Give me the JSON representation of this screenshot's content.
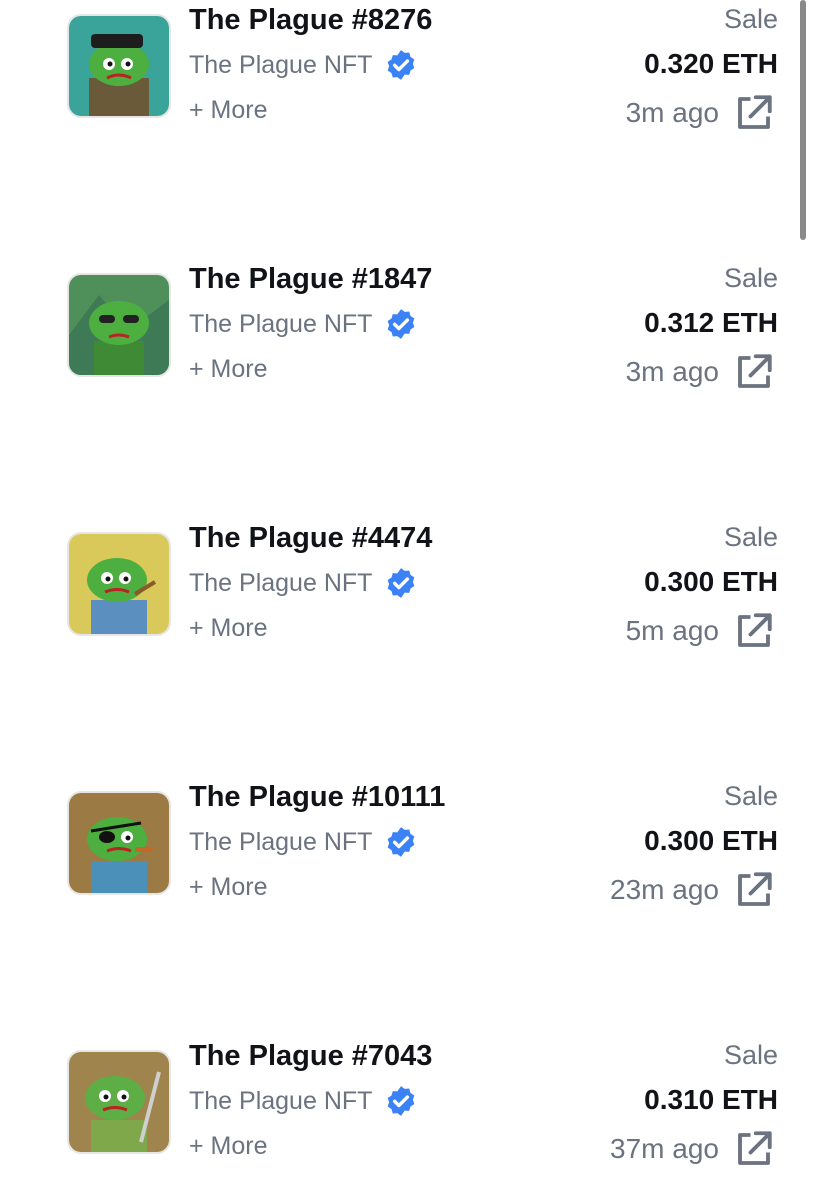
{
  "colors": {
    "title": "#111318",
    "muted": "#6b7280",
    "verified_badge": "#3b82f6"
  },
  "items": [
    {
      "title": "The Plague #8276",
      "collection": "The Plague NFT",
      "more": "+ More",
      "event": "Sale",
      "price": "0.320 ETH",
      "time": "3m ago",
      "thumb_bg": "#3aa39a"
    },
    {
      "title": "The Plague #1847",
      "collection": "The Plague NFT",
      "more": "+ More",
      "event": "Sale",
      "price": "0.312 ETH",
      "time": "3m ago",
      "thumb_bg": "#4f8f5a"
    },
    {
      "title": "The Plague #4474",
      "collection": "The Plague NFT",
      "more": "+ More",
      "event": "Sale",
      "price": "0.300 ETH",
      "time": "5m ago",
      "thumb_bg": "#d9c95a"
    },
    {
      "title": "The Plague #10111",
      "collection": "The Plague NFT",
      "more": "+ More",
      "event": "Sale",
      "price": "0.300 ETH",
      "time": "23m ago",
      "thumb_bg": "#9b7a44"
    },
    {
      "title": "The Plague #7043",
      "collection": "The Plague NFT",
      "more": "+ More",
      "event": "Sale",
      "price": "0.310 ETH",
      "time": "37m ago",
      "thumb_bg": "#a0844d"
    }
  ]
}
